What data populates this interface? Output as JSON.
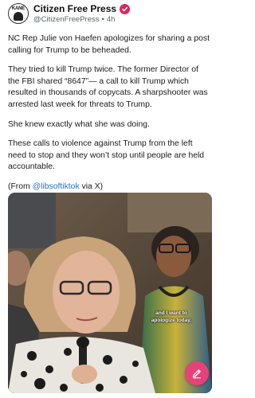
{
  "post": {
    "author_name": "Citizen Free Press",
    "avatar_text": "KANE",
    "handle": "@CitizenFreePress",
    "separator": "•",
    "time": "4h",
    "paragraphs": [
      "NC Rep Julie von Haefen apologizes for sharing a post calling for Trump to be beheaded.",
      "They tried to kill Trump twice. The former Director of the FBI shared “8647”— a call to kill Trump which resulted in thousands of copycats. A sharpshooter was arrested last week for threats to Trump.",
      "She knew exactly what she was doing.",
      "These calls to violence against Trump from the left need to stop and they won’t stop until people are held accountable."
    ],
    "source_prefix": "(From ",
    "source_mention": "@libsoftiktok",
    "source_suffix": " via X)"
  },
  "media": {
    "caption_line1": "and I want to",
    "caption_line2": "apologize today."
  },
  "colors": {
    "verified": "#e0245e",
    "mention": "#1d72c9",
    "fab": "#e8417a"
  },
  "icons": {
    "verified": "verified-badge-icon",
    "fab": "compose-icon"
  }
}
